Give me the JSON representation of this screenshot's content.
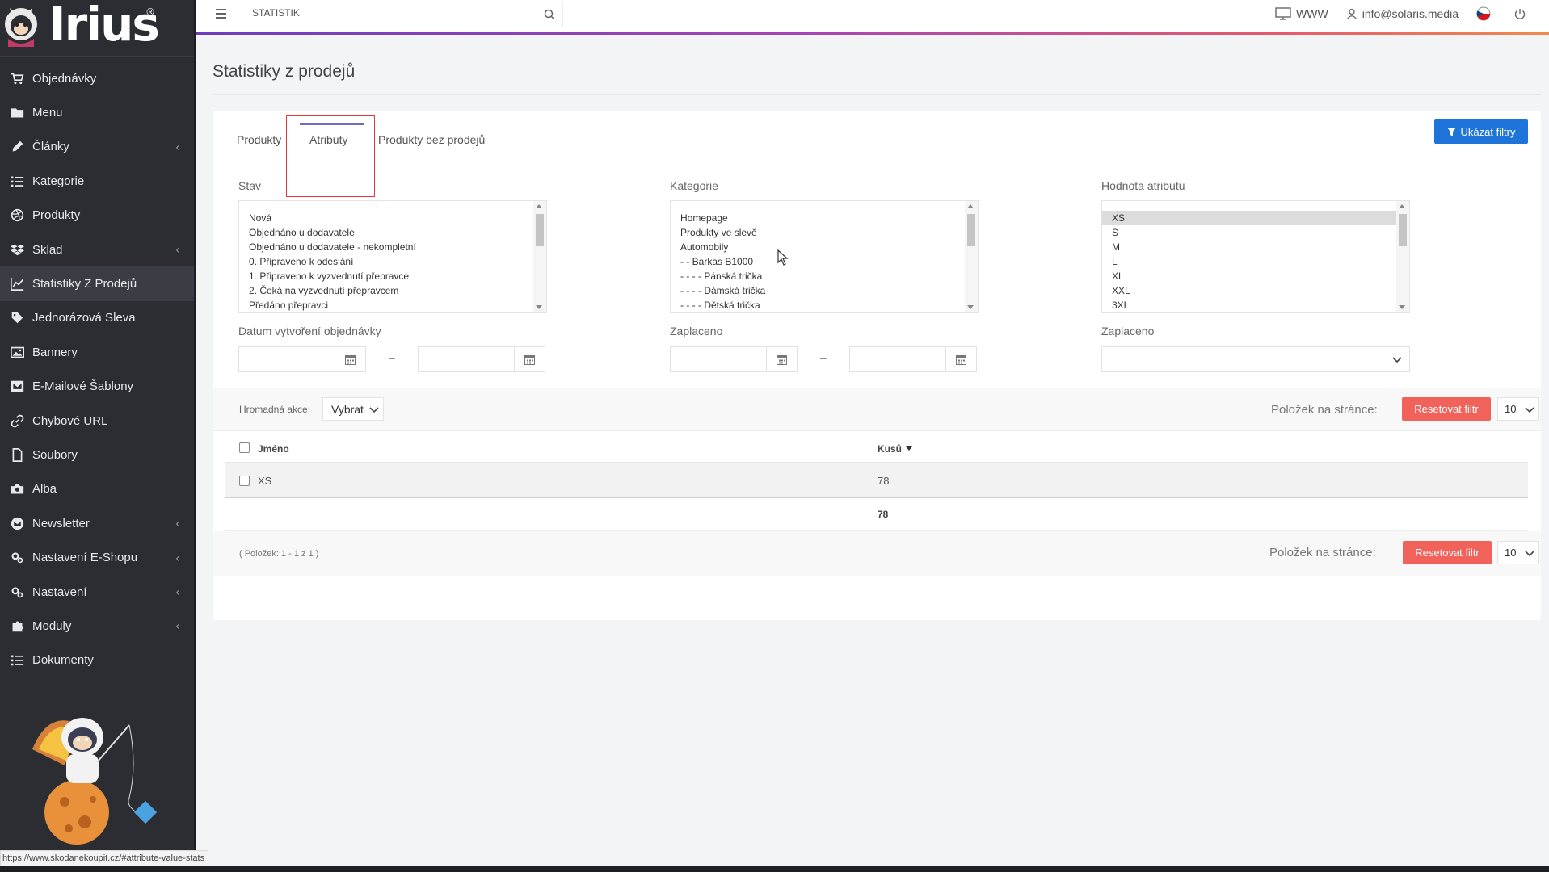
{
  "brand": {
    "logo_text": "Irius",
    "registered": "®"
  },
  "sidebar": {
    "items": [
      {
        "label": "Objednávky",
        "icon": "cart-icon",
        "has_submenu": false
      },
      {
        "label": "Menu",
        "icon": "folder-icon",
        "has_submenu": false
      },
      {
        "label": "Články",
        "icon": "pencil-icon",
        "has_submenu": true
      },
      {
        "label": "Kategorie",
        "icon": "list-icon",
        "has_submenu": false
      },
      {
        "label": "Produkty",
        "icon": "dribbble-icon",
        "has_submenu": false
      },
      {
        "label": "Sklad",
        "icon": "dropbox-icon",
        "has_submenu": true
      },
      {
        "label": "Statistiky Z Prodejů",
        "icon": "line-chart-icon",
        "has_submenu": false,
        "active": true
      },
      {
        "label": "Jednorázová Sleva",
        "icon": "tag-icon",
        "has_submenu": false
      },
      {
        "label": "Bannery",
        "icon": "image-icon",
        "has_submenu": false
      },
      {
        "label": "E-Mailové Šablony",
        "icon": "envelope-square-icon",
        "has_submenu": false
      },
      {
        "label": "Chybové URL",
        "icon": "link-icon",
        "has_submenu": false
      },
      {
        "label": "Soubory",
        "icon": "file-icon",
        "has_submenu": false
      },
      {
        "label": "Alba",
        "icon": "camera-icon",
        "has_submenu": false
      },
      {
        "label": "Newsletter",
        "icon": "newsletter-icon",
        "has_submenu": true
      },
      {
        "label": "Nastavení E-Shopu",
        "icon": "cogs-icon",
        "has_submenu": true
      },
      {
        "label": "Nastavení",
        "icon": "cogs-icon",
        "has_submenu": true
      },
      {
        "label": "Moduly",
        "icon": "puzzle-icon",
        "has_submenu": true
      },
      {
        "label": "Dokumenty",
        "icon": "list-icon",
        "has_submenu": false
      }
    ]
  },
  "topbar": {
    "search_value": "STATISTIK",
    "www_label": "WWW",
    "user_email": "info@solaris.media"
  },
  "page": {
    "title": "Statistiky z prodejů"
  },
  "tabs": [
    {
      "label": "Produkty"
    },
    {
      "label": "Atributy",
      "active": true
    },
    {
      "label": "Produkty bez prodejů"
    }
  ],
  "filters": {
    "show_button": "Ukázat filtry",
    "stav": {
      "label": "Stav",
      "options": [
        "Nová",
        "Objednáno u dodavatele",
        "Objednáno u dodavatele - nekompletní",
        "0. Připraveno k odeslání",
        "1. Připraveno k vyzvednutí přepravce",
        "2. Čeká na vyzvednutí přepravcem",
        "Předáno přepravci"
      ]
    },
    "kategorie": {
      "label": "Kategorie",
      "options": [
        "Homepage",
        "Produkty ve slevě",
        "Automobily",
        "- - Barkas B1000",
        "- - - - Pánská trička",
        "- - - - Dámská trička",
        "- - - - Dětská trička"
      ]
    },
    "hodnota": {
      "label": "Hodnota atributu",
      "options": [
        "XS",
        "S",
        "M",
        "L",
        "XL",
        "XXL",
        "3XL"
      ],
      "selected": "XS"
    },
    "datum_label": "Datum vytvoření objednávky",
    "zaplaceno_label": "Zaplaceno",
    "zaplaceno2_label": "Zaplaceno",
    "range_dash": "–"
  },
  "bulk": {
    "label": "Hromadná akce:",
    "value": "Vybrat"
  },
  "pagination": {
    "per_page_label": "Položek na stránce:",
    "reset_label": "Resetovat filtr",
    "per_page_value": "10",
    "count_text": "( Položek: 1 - 1 z 1 )"
  },
  "table": {
    "columns": {
      "name": "Jméno",
      "pieces": "Kusů"
    },
    "rows": [
      {
        "name": "XS",
        "pieces": "78"
      }
    ],
    "total": "78"
  },
  "status_bar": {
    "url": "https://www.skodanekoupit.cz/#attribute-value-stats"
  }
}
